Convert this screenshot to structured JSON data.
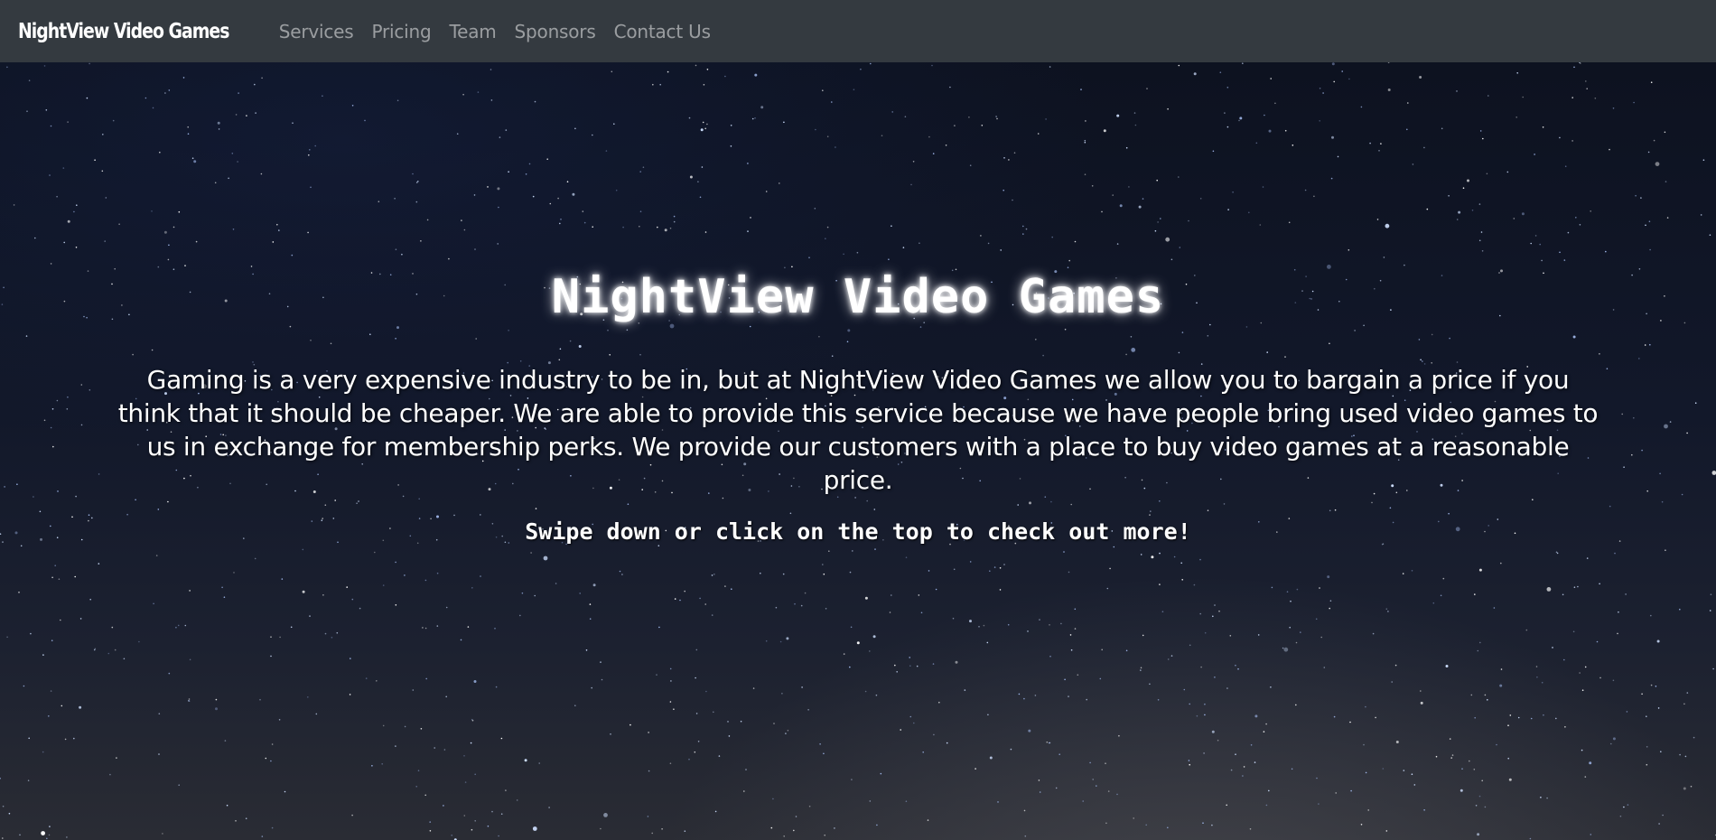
{
  "nav": {
    "brand": "NightView Video Games",
    "links": [
      {
        "label": "Services"
      },
      {
        "label": "Pricing"
      },
      {
        "label": "Team"
      },
      {
        "label": "Sponsors"
      },
      {
        "label": "Contact Us"
      }
    ]
  },
  "hero": {
    "title": "NightView Video Games",
    "description": "Gaming is a very expensive industry to be in, but at NightView Video Games we allow you to bargain a price if you think that it should be cheaper. We are able to provide this service because we have people bring used video games to us in exchange for membership perks. We provide our customers with a place to buy video games at a reasonable price.",
    "cta": "Swipe down or click on the top to check out more!"
  },
  "colors": {
    "navbar_bg": "#343a40",
    "nav_link": "#8f9398",
    "brand": "#ffffff",
    "hero_text": "#ffffff"
  }
}
